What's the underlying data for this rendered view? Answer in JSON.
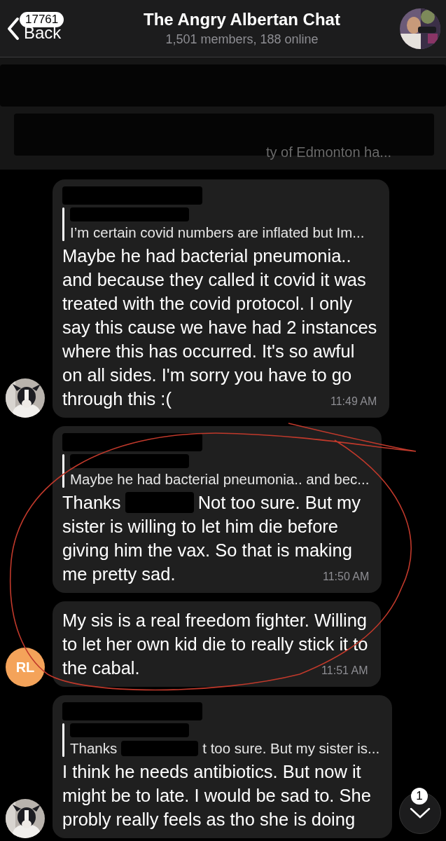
{
  "header": {
    "back_badge": "17761",
    "back_label": "Back",
    "title": "The Angry Albertan Chat",
    "subtitle": "1,501 members, 188 online"
  },
  "pinned": {
    "fragment": "ty of Edmonton ha..."
  },
  "messages": [
    {
      "reply": {
        "segments": [
          {
            "kind": "text",
            "text": "I’m certain covid numbers are inflated but Im..."
          }
        ]
      },
      "lines": [
        [
          {
            "kind": "text",
            "text": "Maybe he had bacterial pneumonia.."
          }
        ],
        [
          {
            "kind": "text",
            "text": "and because they called it covid it was"
          }
        ],
        [
          {
            "kind": "text",
            "text": "treated with the covid protocol. I only"
          }
        ],
        [
          {
            "kind": "text",
            "text": "say this cause we have had 2 instances"
          }
        ],
        [
          {
            "kind": "text",
            "text": "where this has occurred. It's so awful"
          }
        ],
        [
          {
            "kind": "text",
            "text": "on all sides. I'm sorry you have to go"
          }
        ],
        [
          {
            "kind": "text",
            "text": "through this :("
          }
        ]
      ],
      "time": "11:49 AM",
      "avatar": {
        "kind": "picture"
      }
    },
    {
      "reply": {
        "segments": [
          {
            "kind": "text",
            "text": "Maybe he had bacterial pneumonia.. and bec..."
          }
        ]
      },
      "lines": [
        [
          {
            "kind": "text",
            "text": "Thanks"
          },
          {
            "kind": "redacted"
          },
          {
            "kind": "text",
            "text": "Not too sure. But my"
          }
        ],
        [
          {
            "kind": "text",
            "text": "sister is willing to let him die before"
          }
        ],
        [
          {
            "kind": "text",
            "text": "giving him the vax. So that is making"
          }
        ],
        [
          {
            "kind": "text",
            "text": "me pretty sad."
          }
        ]
      ],
      "time": "11:50 AM",
      "avatar": {
        "kind": "none"
      }
    },
    {
      "lines": [
        [
          {
            "kind": "text",
            "text": "My sis is a real freedom fighter. Willing"
          }
        ],
        [
          {
            "kind": "text",
            "text": "to let her own kid die to really stick it to"
          }
        ],
        [
          {
            "kind": "text",
            "text": "the cabal."
          }
        ]
      ],
      "time": "11:51 AM",
      "avatar": {
        "kind": "initials",
        "text": "RL",
        "color": "#f4a35a"
      }
    },
    {
      "reply": {
        "segments": [
          {
            "kind": "text",
            "text": "Thanks"
          },
          {
            "kind": "redacted"
          },
          {
            "kind": "text",
            "text": "t too sure. But my sister is..."
          }
        ]
      },
      "lines": [
        [
          {
            "kind": "text",
            "text": "I think he needs antibiotics. But now it"
          }
        ],
        [
          {
            "kind": "text",
            "text": "might be to late. I would be sad to. She"
          }
        ],
        [
          {
            "kind": "text",
            "text": "probly really feels as tho she is doing"
          }
        ]
      ],
      "avatar": {
        "kind": "picture"
      }
    }
  ],
  "scroll_button": {
    "badge": "1"
  }
}
